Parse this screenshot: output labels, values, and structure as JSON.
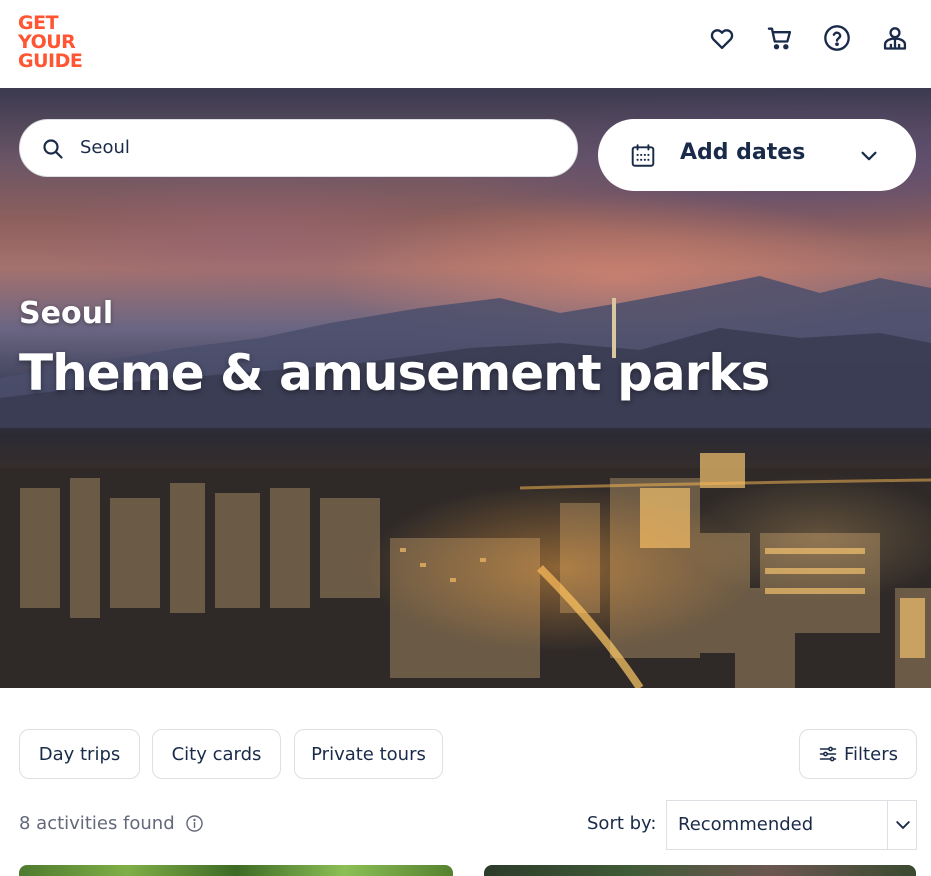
{
  "header": {
    "logo_lines": [
      "GET",
      "YOUR",
      "GUIDE"
    ],
    "icons": [
      "heart-icon",
      "cart-icon",
      "help-icon",
      "user-icon"
    ]
  },
  "search": {
    "value": "Seoul"
  },
  "dates": {
    "label": "Add dates"
  },
  "hero": {
    "subtitle": "Seoul",
    "title": "Theme & amusement parks"
  },
  "chips": [
    {
      "label": "Day trips"
    },
    {
      "label": "City cards"
    },
    {
      "label": "Private tours"
    }
  ],
  "filters": {
    "label": "Filters"
  },
  "results": {
    "count_text": "8 activities found"
  },
  "sort": {
    "label": "Sort by:",
    "value": "Recommended"
  },
  "colors": {
    "brand": "#ff5533",
    "text": "#1a2b49",
    "muted": "#63687a",
    "border": "#dcdfe4"
  }
}
